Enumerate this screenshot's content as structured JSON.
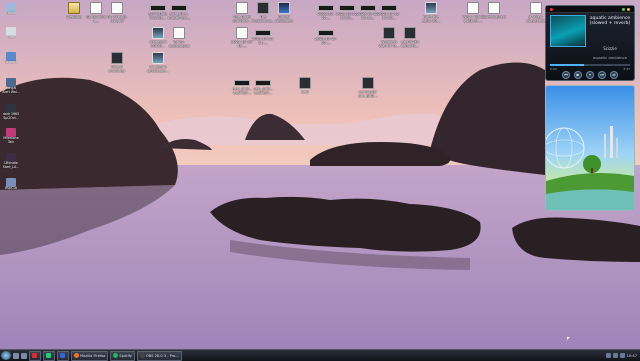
{
  "desktop": {
    "icons_top": [
      {
        "label": "Desktop",
        "kind": "folder"
      },
      {
        "label": "GE Routing 1...",
        "kind": "doc"
      },
      {
        "label": "GE Activity List.pdf",
        "kind": "doc"
      },
      {
        "label": "Sci7d16dL 55sx6E...",
        "kind": "img"
      },
      {
        "label": "attractive-sunset-wal...",
        "kind": "img"
      },
      {
        "label": "The Good Girl Now...",
        "kind": "doc"
      },
      {
        "label": "The Importance...",
        "kind": "img"
      },
      {
        "label": "Global Wallpaper",
        "kind": "media"
      },
      {
        "label": "2023-10-12-...",
        "kind": "strip"
      },
      {
        "label": "2023-10-12-15-55...",
        "kind": "strip"
      },
      {
        "label": "2023-10-12-16-12...",
        "kind": "strip"
      },
      {
        "label": "2023-10-12-16-30...",
        "kind": "strip"
      },
      {
        "label": "from the early-30...",
        "kind": "img"
      },
      {
        "label": "Why I think quitting ...",
        "kind": "doc"
      },
      {
        "label": "download.txt",
        "kind": "doc"
      },
      {
        "label": "jr-video-player.exe",
        "kind": "doc"
      }
    ],
    "icons_row2": [
      {
        "label": "whitebolt SOLID...",
        "kind": "img"
      },
      {
        "label": "funny-quotes.png",
        "kind": "img"
      },
      {
        "label": "2023-10-20-18-...",
        "kind": "doc"
      },
      {
        "label": "2023-10-20-21-...",
        "kind": "img"
      },
      {
        "label": "2023-10-12-20-...",
        "kind": "strip"
      },
      {
        "label": "Windows Warrior D...",
        "kind": "dark"
      },
      {
        "label": "ezePR4X8 default6...",
        "kind": "dark"
      }
    ],
    "icons_row3": [
      {
        "label": "Colour shock.tar",
        "kind": "dark"
      },
      {
        "label": "lol-gleam landscape...",
        "kind": "img"
      }
    ],
    "icons_row4": [
      {
        "label": "new_prof... washroll...",
        "kind": "img"
      },
      {
        "label": "new_prof... washroll...",
        "kind": "img"
      },
      {
        "label": "bed",
        "kind": "dark"
      },
      {
        "label": "contrastor pro_BUD...",
        "kind": "dark"
      }
    ],
    "left_icons": [
      {
        "label": "Home",
        "color": "#9db8d8"
      },
      {
        "label": "Trash",
        "color": "#d8dde4"
      },
      {
        "label": "Network",
        "color": "#5a88c8"
      },
      {
        "label": "Fungal Alert Wal...",
        "color": "#4d6a8f"
      },
      {
        "label": "dark 1965 Spi2Oct...",
        "color": "#2d3440"
      },
      {
        "label": "Milestone Talk",
        "color": "#c23a7a"
      },
      {
        "label": "Ultimate Start_LA...",
        "color": "#3a2d44"
      },
      {
        "label": "tRipCut",
        "color": "#7a8fb8"
      }
    ]
  },
  "player": {
    "track": "aquatic ambience (slowed + reverb)",
    "artist": "Scizzie",
    "subtitle": "aquatic ambience",
    "elapsed": "0:00",
    "total": "3:37",
    "progress": 0.42,
    "controls": [
      "prev",
      "play",
      "pause",
      "next",
      "shuffle"
    ],
    "control_glyphs": [
      "⏮",
      "▶",
      "⏸",
      "⏭",
      "⇄"
    ]
  },
  "taskbar": {
    "tasks": [
      {
        "label": "",
        "color": "#c33"
      },
      {
        "label": "",
        "color": "#2c7"
      },
      {
        "label": "",
        "color": "#36c"
      },
      {
        "label": "Mozilla Firefox",
        "color": "#e8742a"
      },
      {
        "label": "Spotify",
        "color": "#1db954"
      },
      {
        "label": "OBS 28.0.3 - Pro...",
        "color": "#444"
      }
    ],
    "clock": "10:47"
  },
  "colors": {
    "sky_top": "#d9b6c8",
    "sky_mid": "#f2c4b4",
    "water": "#b79ac0"
  }
}
